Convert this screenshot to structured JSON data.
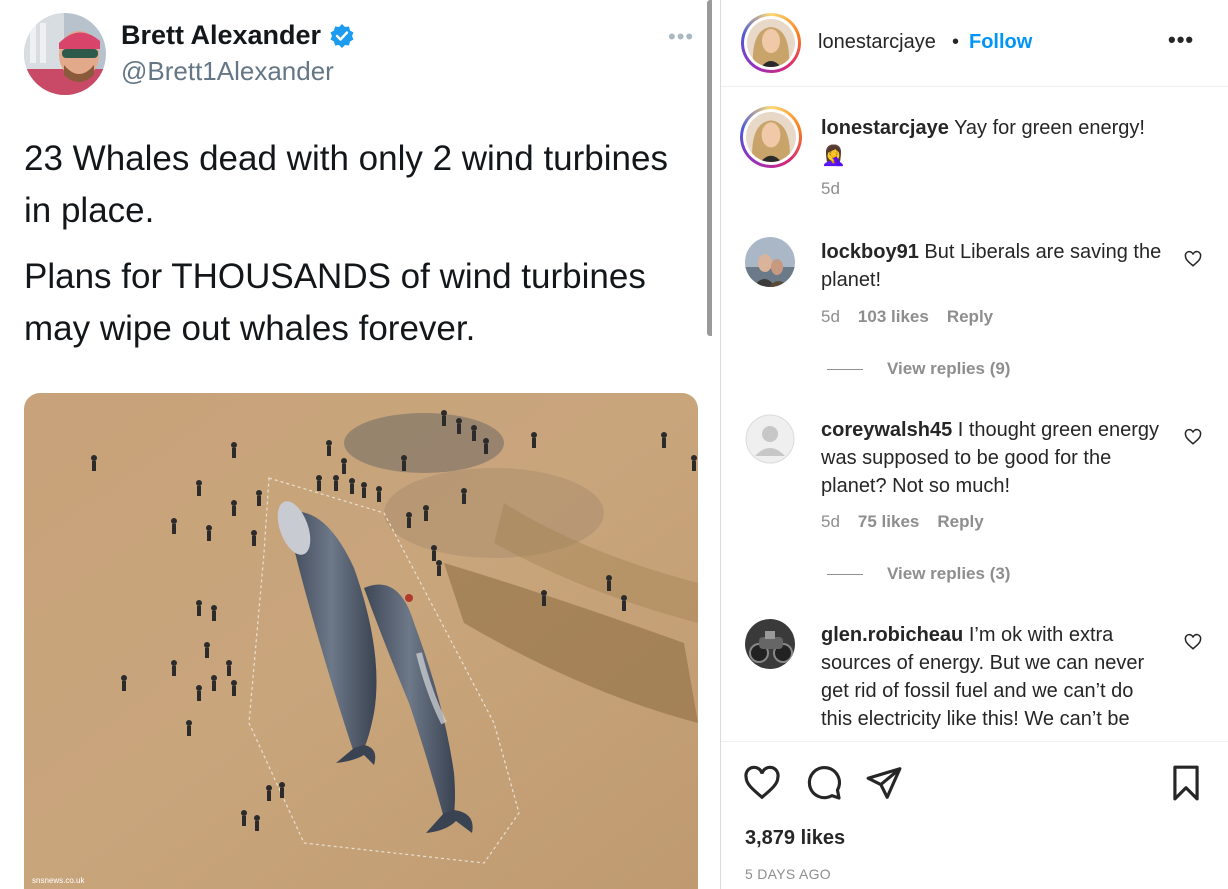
{
  "tweet": {
    "name": "Brett Alexander",
    "handle": "@Brett1Alexander",
    "more": "•••",
    "text_1": "23 Whales dead with only 2 wind turbines in place.",
    "text_2": "Plans for THOUSANDS of wind turbines may wipe out whales forever.",
    "watermark": "snsnews.co.uk"
  },
  "post": {
    "header": {
      "username": "lonestarcjaye",
      "dot": "•",
      "follow_label": "Follow",
      "more": "•••"
    },
    "caption": {
      "username": "lonestarcjaye",
      "text": "Yay for green energy!",
      "emoji": "🤦‍♀️",
      "time": "5d"
    },
    "comments": [
      {
        "username": "lockboy91",
        "text": "But Liberals are saving the planet!",
        "time": "5d",
        "likes": "103 likes",
        "reply": "Reply",
        "view_replies": "View replies (9)"
      },
      {
        "username": "coreywalsh45",
        "text": "I thought green energy was supposed to be good for the planet? Not so much!",
        "time": "5d",
        "likes": "75 likes",
        "reply": "Reply",
        "view_replies": "View replies (3)"
      },
      {
        "username": "glen.robicheau",
        "text": "I’m ok with extra sources of energy. But we can never get rid of fossil fuel and we can’t do this electricity like this! We can’t be"
      }
    ],
    "likes": "3,879 likes",
    "posted": "5 DAYS AGO"
  },
  "colors": {
    "link_blue": "#0095f6",
    "verified_blue": "#1d9bf0",
    "muted": "#8e8e8e",
    "sand": "#c9a57a"
  }
}
